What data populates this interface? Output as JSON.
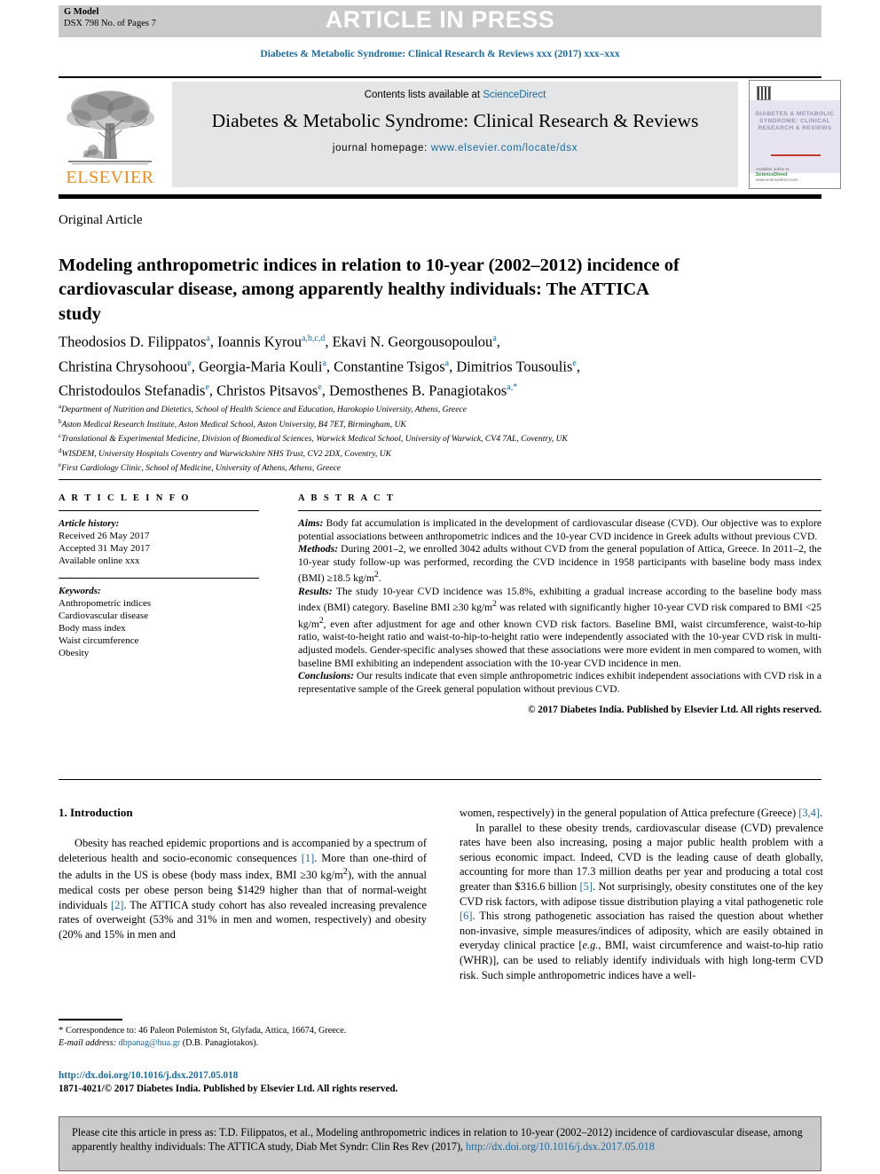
{
  "banner": {
    "gmodel_line1": "G Model",
    "gmodel_line2": "DSX 798 No. of Pages 7",
    "press_text": "ARTICLE IN PRESS"
  },
  "running_head": "Diabetes & Metabolic Syndrome: Clinical Research & Reviews xxx (2017) xxx–xxx",
  "masthead": {
    "contents_prefix": "Contents lists available at ",
    "sciencedirect": "ScienceDirect",
    "journal_title": "Diabetes & Metabolic Syndrome: Clinical Research & Reviews",
    "homepage_label": "journal homepage: ",
    "homepage_url": "www.elsevier.com/locate/dsx",
    "publisher": "ELSEVIER",
    "cover": {
      "words": "DIABETES & METABOLIC SYNDROME: CLINICAL RESEARCH & REVIEWS",
      "foot_label": "Available online at",
      "foot_brand": "ScienceDirect",
      "foot_url": "www.sciencedirect.com"
    }
  },
  "article": {
    "type": "Original Article",
    "title": "Modeling anthropometric indices in relation to 10-year (2002–2012) incidence of cardiovascular disease, among apparently healthy individuals: The ATTICA study",
    "authors_line1": "Theodosios D. Filippatos<sup>a</sup>, Ioannis Kyrou<sup>a,b,c,d</sup>, Ekavi N. Georgousopoulou<sup>a</sup>,",
    "authors_line2": "Christina Chrysohoou<sup>e</sup>, Georgia-Maria Kouli<sup>a</sup>, Constantine Tsigos<sup>a</sup>, Dimitrios Tousoulis<sup>e</sup>,",
    "authors_line3": "Christodoulos Stefanadis<sup>e</sup>, Christos Pitsavos<sup>e</sup>, Demosthenes B. Panagiotakos<sup>a,*</sup>",
    "affiliations": [
      {
        "marker": "a",
        "text": "Department of Nutrition and Dietetics, School of Health Science and Education, Harokopio University, Athens, Greece"
      },
      {
        "marker": "b",
        "text": "Aston Medical Research Institute, Aston Medical School, Aston University, B4 7ET, Birmingham, UK"
      },
      {
        "marker": "c",
        "text": "Translational & Experimental Medicine, Division of Biomedical Sciences, Warwick Medical School, University of Warwick, CV4 7AL, Coventry, UK"
      },
      {
        "marker": "d",
        "text": "WISDEM, University Hospitals Coventry and Warwickshire NHS Trust, CV2 2DX, Coventry, UK"
      },
      {
        "marker": "e",
        "text": "First Cardiology Clinic, School of Medicine, University of Athens, Athens, Greece"
      }
    ]
  },
  "article_info": {
    "heading": "A R T I C L E   I N F O",
    "history_label": "Article history:",
    "history": [
      "Received 26 May 2017",
      "Accepted 31 May 2017",
      "Available online xxx"
    ],
    "keywords_label": "Keywords:",
    "keywords": [
      "Anthropometric indices",
      "Cardiovascular disease",
      "Body mass index",
      "Waist circumference",
      "Obesity"
    ]
  },
  "abstract": {
    "heading": "A B S T R A C T",
    "aims_label": "Aims:",
    "aims_text": " Body fat accumulation is implicated in the development of cardiovascular disease (CVD). Our objective was to explore potential associations between anthropometric indices and the 10-year CVD incidence in Greek adults without previous CVD.",
    "methods_label": "Methods:",
    "methods_text": " During 2001–2, we enrolled 3042 adults without CVD from the general population of Attica, Greece. In 2011–2, the 10-year study follow-up was performed, recording the CVD incidence in 1958 participants with baseline body mass index (BMI) ≥18.5 kg/m2.",
    "results_label": "Results:",
    "results_text": " The study 10-year CVD incidence was 15.8%, exhibiting a gradual increase according to the baseline body mass index (BMI) category. Baseline BMI ≥30 kg/m2 was related with significantly higher 10-year CVD risk compared to BMI <25 kg/m2, even after adjustment for age and other known CVD risk factors. Baseline BMI, waist circumference, waist-to-hip ratio, waist-to-height ratio and waist-to-hip-to-height ratio were independently associated with the 10-year CVD risk in multi-adjusted models. Gender-specific analyses showed that these associations were more evident in men compared to women, with baseline BMI exhibiting an independent association with the 10-year CVD incidence in men.",
    "conclusions_label": "Conclusions:",
    "conclusions_text": " Our results indicate that even simple anthropometric indices exhibit independent associations with CVD risk in a representative sample of the Greek general population without previous CVD.",
    "copyright": "© 2017 Diabetes India. Published by Elsevier Ltd. All rights reserved."
  },
  "body": {
    "section_title": "1. Introduction",
    "left_para_1_a": "Obesity has reached epidemic proportions and is accompanied by a spectrum of deleterious health and socio-economic consequences ",
    "left_ref_1": "[1]",
    "left_para_1_b": ". More than one-third of the adults in the US is obese (body mass index, BMI ≥30 kg/m2), with the annual medical costs per obese person being $1429 higher than that of normal-weight individuals ",
    "left_ref_2": "[2]",
    "left_para_1_c": ". The ATTICA study cohort has also revealed increasing prevalence rates of overweight (53% and 31% in men and women, respectively) and obesity (20% and 15% in men and",
    "right_para_1_a": "women, respectively) in the general population of Attica prefecture (Greece) ",
    "right_ref_34": "[3,4]",
    "right_para_1_b": ".",
    "right_para_2_a": "In parallel to these obesity trends, cardiovascular disease (CVD) prevalence rates have been also increasing, posing a major public health problem with a serious economic impact. Indeed, CVD is the leading cause of death globally, accounting for more than 17.3 million deaths per year and producing a total cost greater than $316.6 billion ",
    "right_ref_5": "[5]",
    "right_para_2_b": ". Not surprisingly, obesity constitutes one of the key CVD risk factors, with adipose tissue distribution playing a vital pathogenetic role ",
    "right_ref_6": "[6]",
    "right_para_2_c": ". This strong pathogenetic association has raised the question about whether non-invasive, simple measures/indices of adiposity, which are easily obtained in everyday clinical practice [",
    "right_eg": "e.g.",
    "right_para_2_d": ", BMI, waist circumference and waist-to-hip ratio (WHR)], can be used to reliably identify individuals with high long-term CVD risk. Such simple anthropometric indices have a well-"
  },
  "footnote": {
    "marker": "*",
    "correspondence": "Correspondence to: 46 Paleon Polemiston St, Glyfada, Attica, 16674, Greece.",
    "email_label": "E-mail address:",
    "email": "dbpanag@hua.gr",
    "email_suffix": "(D.B. Panagiotakos)."
  },
  "doi_block": {
    "doi": "http://dx.doi.org/10.1016/j.dsx.2017.05.018",
    "issn": "1871-4021/© 2017 Diabetes India. Published by Elsevier Ltd. All rights reserved."
  },
  "cite_box": {
    "text_a": "Please cite this article in press as: T.D. Filippatos, et al., Modeling anthropometric indices in relation to 10-year (2002–2012) incidence of cardiovascular disease, among apparently healthy individuals: The ATTICA study, Diab Met Syndr: Clin Res Rev (2017), ",
    "link": "http://dx.doi.org/10.1016/j.dsx.2017.05.018"
  },
  "colors": {
    "link_blue": "#1a6ba0",
    "banner_gray": "#c9c9c9",
    "masthead_gray": "#e4e5e6",
    "elsevier_orange": "#f08c1c"
  }
}
